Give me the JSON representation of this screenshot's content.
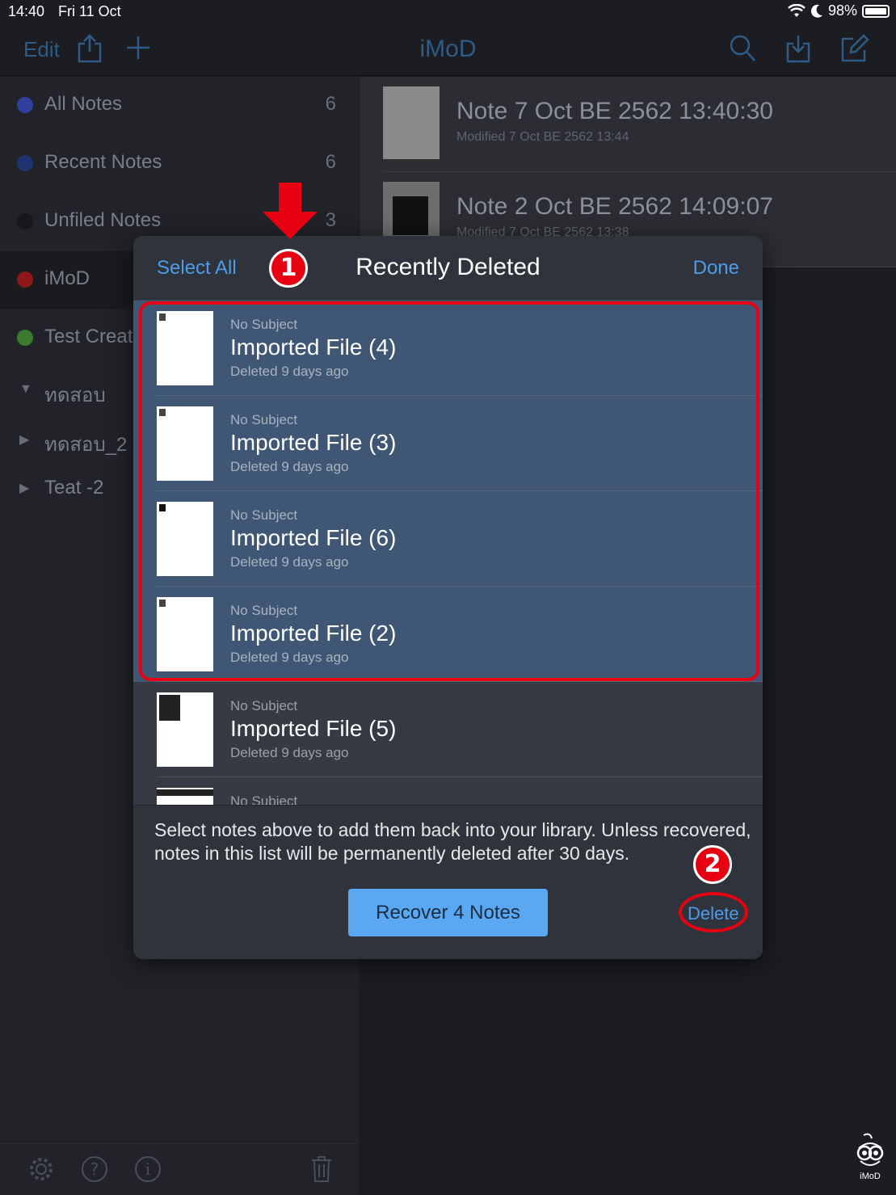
{
  "status": {
    "time": "14:40",
    "date": "Fri 11 Oct",
    "battery": "98%"
  },
  "nav": {
    "edit": "Edit",
    "title": "iMoD"
  },
  "sidebar": {
    "items": [
      {
        "label": "All Notes",
        "count": "6",
        "color": "#2e3f9e"
      },
      {
        "label": "Recent Notes",
        "count": "6",
        "color": "#1e3470"
      },
      {
        "label": "Unfiled Notes",
        "count": "3",
        "color": "#15171b"
      },
      {
        "label": "iMoD",
        "count": "",
        "color": "#8e1919"
      },
      {
        "label": "Test Create",
        "count": "",
        "color": "#3d7a31"
      }
    ],
    "tree": [
      {
        "label": "ทดสอบ"
      },
      {
        "label": "ทดสอบ_2"
      },
      {
        "label": "Teat -2"
      }
    ]
  },
  "notes": [
    {
      "title": "Note 7 Oct BE 2562 13:40:30",
      "sub": "Modified 7 Oct BE 2562 13:44"
    },
    {
      "title": "Note 2 Oct BE 2562 14:09:07",
      "sub": "Modified 7 Oct BE 2562 13:38"
    }
  ],
  "modal": {
    "select_all": "Select All",
    "title": "Recently Deleted",
    "done": "Done",
    "items": [
      {
        "subject": "No Subject",
        "name": "Imported File (4)",
        "meta": "Deleted 9 days ago"
      },
      {
        "subject": "No Subject",
        "name": "Imported File (3)",
        "meta": "Deleted 9 days ago"
      },
      {
        "subject": "No Subject",
        "name": "Imported File (6)",
        "meta": "Deleted 9 days ago"
      },
      {
        "subject": "No Subject",
        "name": "Imported File (2)",
        "meta": "Deleted 9 days ago"
      },
      {
        "subject": "No Subject",
        "name": "Imported File (5)",
        "meta": "Deleted 9 days ago"
      },
      {
        "subject": "No Subject",
        "name": "",
        "meta": ""
      }
    ],
    "footer_text": "Select notes above to add them back into your library. Unless recovered, notes in this list will be permanently deleted after 30 days.",
    "recover_label": "Recover 4 Notes",
    "delete_label": "Delete"
  },
  "annotations": {
    "step1": "1",
    "step2": "2",
    "color": "#e60012"
  },
  "watermark": "iMoD"
}
